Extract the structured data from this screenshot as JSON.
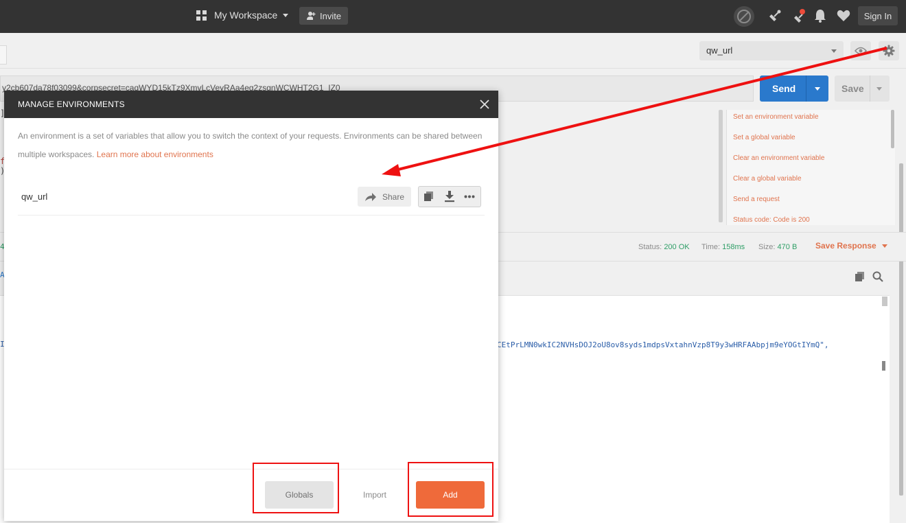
{
  "topbar": {
    "workspace_label": "My Workspace",
    "invite_label": "Invite",
    "signin_label": "Sign In"
  },
  "environment": {
    "selected": "qw_url"
  },
  "request": {
    "url_fragment": "y2cb607da78f03099&corpsecret=caqWYD15kTz9XmvLcVeyRAa4eg2zsgnWCWHT2G1_IZ0",
    "send_label": "Send",
    "save_label": "Save"
  },
  "snippets": [
    "Set an environment variable",
    "Set a global variable",
    "Clear an environment variable",
    "Clear a global variable",
    "Send a request",
    "Status code: Code is 200"
  ],
  "response": {
    "status_label": "Status:",
    "status_value": "200 OK",
    "time_label": "Time:",
    "time_value": "158ms",
    "size_label": "Size:",
    "size_value": "470 B",
    "save_response_label": "Save Response",
    "token_fragment": "CEtPrLMN0wkIC2NVHsDOJ2oU8ov8syds1mdpsVxtahnVzp8T9y3wHRFAAbpjm9eYOGtIYmQ\","
  },
  "left_glyphs": [
    "]",
    "f",
    ")",
    "4",
    "A",
    "I"
  ],
  "modal": {
    "title": "MANAGE ENVIRONMENTS",
    "description": "An environment is a set of variables that allow you to switch the context of your requests. Environments can be shared between multiple workspaces.",
    "learn_more": "Learn more about environments",
    "environments": [
      {
        "name": "qw_url",
        "share_label": "Share"
      }
    ],
    "globals_label": "Globals",
    "import_label": "Import",
    "add_label": "Add"
  },
  "colors": {
    "accent": "#ef6a3a",
    "primary": "#2a79cc",
    "header": "#333333",
    "annotation": "#ee1111",
    "success": "#2e9e66"
  },
  "icons": [
    "grid-icon",
    "invite-icon",
    "sync-off-icon",
    "satellite-icon",
    "notification-icon",
    "bell-icon",
    "heart-icon",
    "eye-icon",
    "gear-icon",
    "close-icon",
    "share-icon",
    "copy-icon",
    "download-icon",
    "more-icon",
    "search-icon"
  ]
}
